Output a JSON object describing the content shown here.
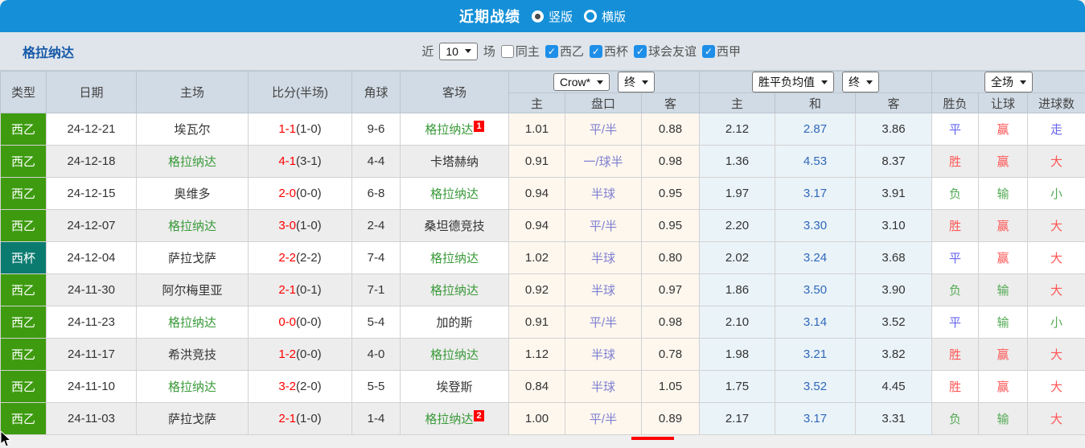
{
  "topbar": {
    "title": "近期战绩",
    "layout_options": [
      {
        "label": "竖版",
        "selected": true
      },
      {
        "label": "横版",
        "selected": false
      }
    ]
  },
  "filterbar": {
    "team_name": "格拉纳达",
    "recent_label": "近",
    "recent_count": "10",
    "unit_label": "场",
    "same_home": {
      "label": "同主",
      "checked": false
    },
    "leagues": [
      {
        "label": "西乙",
        "checked": true
      },
      {
        "label": "西杯",
        "checked": true
      },
      {
        "label": "球会友谊",
        "checked": true
      },
      {
        "label": "西甲",
        "checked": true
      }
    ]
  },
  "table": {
    "columns": {
      "type": "类型",
      "date": "日期",
      "home": "主场",
      "score": "比分(半场)",
      "corner": "角球",
      "away": "客场"
    },
    "group1": {
      "select1": "Crow*",
      "select2": "终",
      "sub": [
        "主",
        "盘口",
        "客"
      ]
    },
    "group2": {
      "select1": "胜平负均值",
      "select2": "终",
      "sub": [
        "主",
        "和",
        "客"
      ]
    },
    "group3": {
      "select1": "全场",
      "sub": [
        "胜负",
        "让球",
        "进球数"
      ]
    },
    "type_map": {
      "西乙": "t-league",
      "西杯": "t-cup",
      "西甲": "t-league"
    },
    "result_map": {
      "胜": "res-red",
      "平": "res-blue",
      "负": "res-green",
      "赢": "res-red",
      "输": "res-green",
      "走": "res-blue",
      "大": "res-red",
      "小": "res-green"
    },
    "rows": [
      {
        "type": "西乙",
        "date": "24-12-21",
        "home": "埃瓦尔",
        "home_team": false,
        "score": "1-1",
        "half": "(1-0)",
        "corner": "9-6",
        "away": "格拉纳达",
        "away_team": true,
        "away_badge": "1",
        "crow_home": "1.01",
        "handicap": "平/半",
        "crow_away": "0.88",
        "avg_home": "2.12",
        "avg_draw": "2.87",
        "avg_away": "3.86",
        "result": "平",
        "handicap_result": "赢",
        "goals_result": "走"
      },
      {
        "type": "西乙",
        "date": "24-12-18",
        "home": "格拉纳达",
        "home_team": true,
        "score": "4-1",
        "half": "(3-1)",
        "corner": "4-4",
        "away": "卡塔赫纳",
        "away_team": false,
        "away_badge": "",
        "crow_home": "0.91",
        "handicap": "一/球半",
        "crow_away": "0.98",
        "avg_home": "1.36",
        "avg_draw": "4.53",
        "avg_away": "8.37",
        "result": "胜",
        "handicap_result": "赢",
        "goals_result": "大"
      },
      {
        "type": "西乙",
        "date": "24-12-15",
        "home": "奥维多",
        "home_team": false,
        "score": "2-0",
        "half": "(0-0)",
        "corner": "6-8",
        "away": "格拉纳达",
        "away_team": true,
        "away_badge": "",
        "crow_home": "0.94",
        "handicap": "半球",
        "crow_away": "0.95",
        "avg_home": "1.97",
        "avg_draw": "3.17",
        "avg_away": "3.91",
        "result": "负",
        "handicap_result": "输",
        "goals_result": "小"
      },
      {
        "type": "西乙",
        "date": "24-12-07",
        "home": "格拉纳达",
        "home_team": true,
        "score": "3-0",
        "half": "(1-0)",
        "corner": "2-4",
        "away": "桑坦德竞技",
        "away_team": false,
        "away_badge": "",
        "crow_home": "0.94",
        "handicap": "平/半",
        "crow_away": "0.95",
        "avg_home": "2.20",
        "avg_draw": "3.30",
        "avg_away": "3.10",
        "result": "胜",
        "handicap_result": "赢",
        "goals_result": "大"
      },
      {
        "type": "西杯",
        "date": "24-12-04",
        "home": "萨拉戈萨",
        "home_team": false,
        "score": "2-2",
        "half": "(2-2)",
        "corner": "7-4",
        "away": "格拉纳达",
        "away_team": true,
        "away_badge": "",
        "crow_home": "1.02",
        "handicap": "半球",
        "crow_away": "0.80",
        "avg_home": "2.02",
        "avg_draw": "3.24",
        "avg_away": "3.68",
        "result": "平",
        "handicap_result": "赢",
        "goals_result": "大"
      },
      {
        "type": "西乙",
        "date": "24-11-30",
        "home": "阿尔梅里亚",
        "home_team": false,
        "score": "2-1",
        "half": "(0-1)",
        "corner": "7-1",
        "away": "格拉纳达",
        "away_team": true,
        "away_badge": "",
        "crow_home": "0.92",
        "handicap": "半球",
        "crow_away": "0.97",
        "avg_home": "1.86",
        "avg_draw": "3.50",
        "avg_away": "3.90",
        "result": "负",
        "handicap_result": "输",
        "goals_result": "大"
      },
      {
        "type": "西乙",
        "date": "24-11-23",
        "home": "格拉纳达",
        "home_team": true,
        "score": "0-0",
        "half": "(0-0)",
        "corner": "5-4",
        "away": "加的斯",
        "away_team": false,
        "away_badge": "",
        "crow_home": "0.91",
        "handicap": "平/半",
        "crow_away": "0.98",
        "avg_home": "2.10",
        "avg_draw": "3.14",
        "avg_away": "3.52",
        "result": "平",
        "handicap_result": "输",
        "goals_result": "小"
      },
      {
        "type": "西乙",
        "date": "24-11-17",
        "home": "希洪竞技",
        "home_team": false,
        "score": "1-2",
        "half": "(0-0)",
        "corner": "4-0",
        "away": "格拉纳达",
        "away_team": true,
        "away_badge": "",
        "crow_home": "1.12",
        "handicap": "半球",
        "crow_away": "0.78",
        "avg_home": "1.98",
        "avg_draw": "3.21",
        "avg_away": "3.82",
        "result": "胜",
        "handicap_result": "赢",
        "goals_result": "大"
      },
      {
        "type": "西乙",
        "date": "24-11-10",
        "home": "格拉纳达",
        "home_team": true,
        "score": "3-2",
        "half": "(2-0)",
        "corner": "5-5",
        "away": "埃登斯",
        "away_team": false,
        "away_badge": "",
        "crow_home": "0.84",
        "handicap": "半球",
        "crow_away": "1.05",
        "avg_home": "1.75",
        "avg_draw": "3.52",
        "avg_away": "4.45",
        "result": "胜",
        "handicap_result": "赢",
        "goals_result": "大"
      },
      {
        "type": "西乙",
        "date": "24-11-03",
        "home": "萨拉戈萨",
        "home_team": false,
        "score": "2-1",
        "half": "(1-0)",
        "corner": "1-4",
        "away": "格拉纳达",
        "away_team": true,
        "away_badge": "2",
        "crow_home": "1.00",
        "handicap": "平/半",
        "crow_away": "0.89",
        "avg_home": "2.17",
        "avg_draw": "3.17",
        "avg_away": "3.31",
        "result": "负",
        "handicap_result": "输",
        "goals_result": "大"
      }
    ]
  },
  "colors": {
    "topbar_bg": "#1590d8",
    "league_green": "#3e9b10",
    "cup_teal": "#0b7b70",
    "team_green": "#3a9a3a",
    "score_red": "#ff0000",
    "handicap_purple": "#8080d0",
    "avg_draw_blue": "#3068b8",
    "result_red": "#ff5555",
    "result_green": "#55aa55",
    "result_blue": "#6666ee",
    "footer_indicator": "#ff0000"
  }
}
